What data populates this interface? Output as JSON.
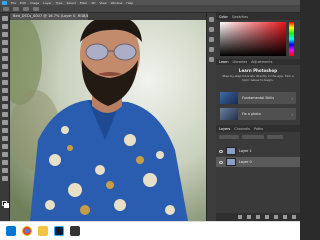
{
  "app": {
    "name": "Photoshop",
    "document_tab": "Bed_DSCs_0007 @ 16.7% (Layer 0, RGB/8#) *",
    "menu": [
      "File",
      "Edit",
      "Image",
      "Layer",
      "Type",
      "Select",
      "Filter",
      "3D",
      "View",
      "Window",
      "Help"
    ]
  },
  "panels": {
    "top_tabs": [
      "Color",
      "Swatches"
    ],
    "learn_tabs": [
      "Learn",
      "Libraries",
      "Adjustments"
    ],
    "learn": {
      "title": "Learn Photoshop",
      "subtitle": "Step-by-step tutorials directly in the app. Pick a topic below to begin."
    },
    "cards": [
      {
        "label": "Fundamental Skills",
        "chevron": "›"
      },
      {
        "label": "Fix a photo",
        "chevron": "›"
      }
    ],
    "layer_tabs": [
      "Layers",
      "Channels",
      "Paths"
    ],
    "layers": [
      {
        "name": "Layer 1"
      },
      {
        "name": "Layer 0"
      }
    ]
  },
  "colors": {
    "accent": "#31a8ff",
    "shirt": "#2a5db0",
    "taskbar": "#ffffff"
  }
}
